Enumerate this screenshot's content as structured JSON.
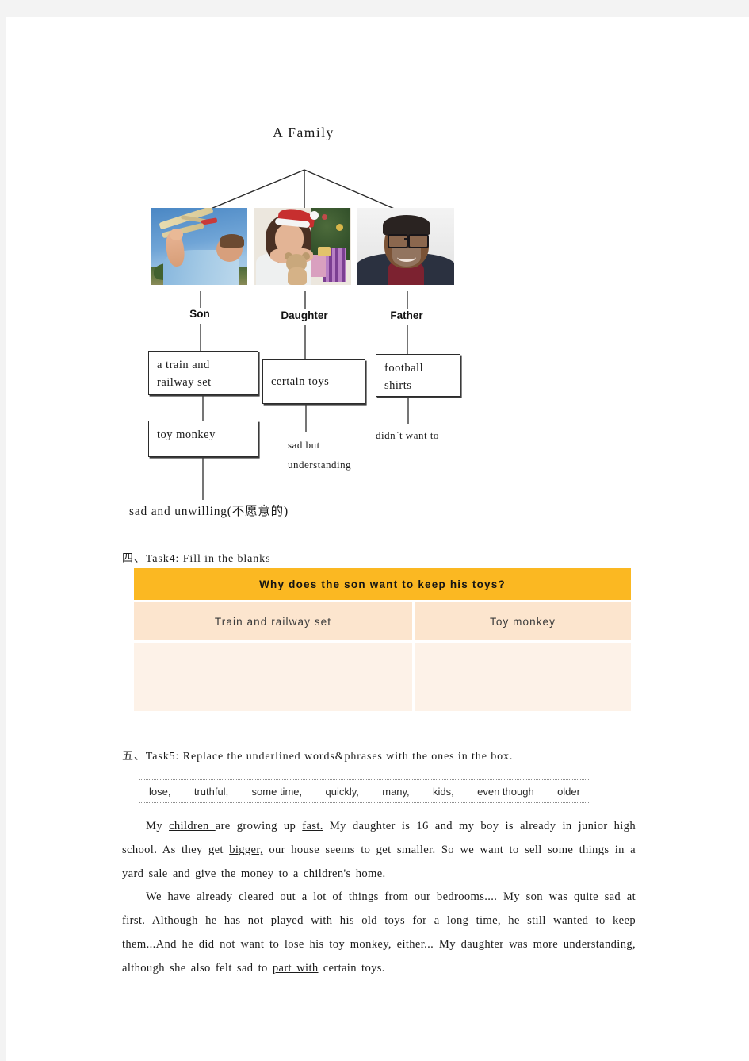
{
  "diagram": {
    "title": "A   Family",
    "roles": [
      {
        "id": "son",
        "label": "Son",
        "photo_alt": "boy-holding-model-airplane"
      },
      {
        "id": "daughter",
        "label": "Daughter",
        "photo_alt": "girl-in-santa-hat-with-teddy-bear"
      },
      {
        "id": "father",
        "label": "Father",
        "photo_alt": "smiling-man-with-glasses"
      }
    ],
    "boxes": {
      "train": "a  train  and\nrailway  set",
      "train_line1": "a  train  and",
      "train_line2": "railway  set",
      "monkey": "toy  monkey",
      "certain": "certain  toys",
      "football_line1": "football",
      "football_line2": "shirts"
    },
    "notes": {
      "sad_but": "sad  but",
      "understanding": "understanding",
      "didnt_want_to": "didn`t  want  to",
      "sad_unwilling": "sad  and  unwilling(不愿意的)"
    }
  },
  "task4": {
    "heading": "四、Task4:  Fill  in  the  blanks",
    "table": {
      "title": "Why  does  the  son  want  to  keep  his  toys?",
      "columns": [
        "Train  and  railway  set",
        "Toy  monkey"
      ],
      "answers": [
        "",
        ""
      ]
    },
    "colors": {
      "header": "#fbb822",
      "subheader": "#fce5ce",
      "body": "#fdf2e8"
    }
  },
  "task5": {
    "heading": "五、Task5:  Replace  the  underlined  words&phrases  with  the  ones  in  the  box.",
    "wordbox": [
      "lose,",
      "truthful,",
      "some time,",
      "quickly,",
      "many,",
      "kids,",
      "even though",
      "older"
    ],
    "paragraph1": {
      "segments": [
        {
          "text": "My ",
          "underline": false
        },
        {
          "text": "children ",
          "underline": true
        },
        {
          "text": "are growing up ",
          "underline": false
        },
        {
          "text": "fast.",
          "underline": true
        },
        {
          "text": " My daughter is 16 and my boy is already in junior high school. As they get ",
          "underline": false
        },
        {
          "text": "bigger,",
          "underline": true
        },
        {
          "text": " our house seems to get smaller. So we want to sell some things in a yard sale and give the money to a children's home.",
          "underline": false
        }
      ]
    },
    "paragraph2": {
      "segments": [
        {
          "text": "We have already cleared out ",
          "underline": false
        },
        {
          "text": "a lot of ",
          "underline": true
        },
        {
          "text": "things from our bedrooms.... My son was quite sad at first. ",
          "underline": false
        },
        {
          "text": "Although ",
          "underline": true
        },
        {
          "text": "he has not played with his old toys for a long time, he still wanted to keep them...And he did not want to lose his toy monkey, either... My daughter was more understanding, although she also felt sad to ",
          "underline": false
        },
        {
          "text": "part with",
          "underline": true
        },
        {
          "text": " certain toys.",
          "underline": false
        }
      ]
    }
  }
}
